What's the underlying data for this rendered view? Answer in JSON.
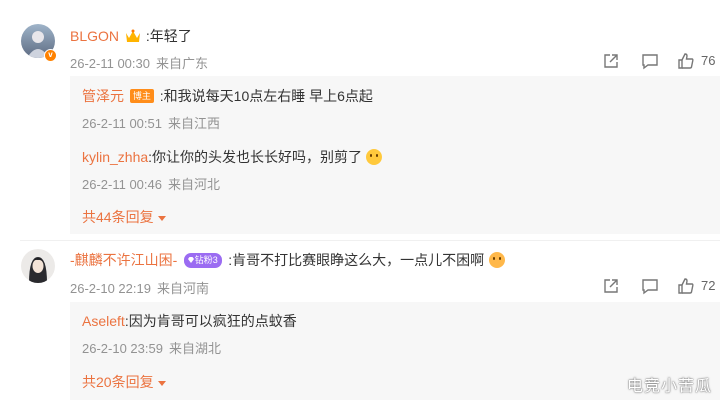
{
  "comments": [
    {
      "user": "BLGON",
      "text": ":年轻了",
      "date": "26-2-11 00:30",
      "location": "来自广东",
      "like_count": "76",
      "replies": [
        {
          "user": "管泽元",
          "tag": "博主",
          "text": ":和我说每天10点左右睡 早上6点起",
          "date": "26-2-11 00:51",
          "location": "来自江西"
        },
        {
          "user": "kylin_zhha",
          "text": ":你让你的头发也长长好吗，别剪了",
          "date": "26-2-11 00:46",
          "location": "来自河北"
        }
      ],
      "more_replies": "共44条回复"
    },
    {
      "user": "-麒麟不许江山困-",
      "fan_tag": "钻粉3",
      "text": ":肯哥不打比赛眼睁这么大，一点儿不困啊",
      "date": "26-2-10 22:19",
      "location": "来自河南",
      "like_count": "72",
      "replies": [
        {
          "user": "Aseleft",
          "text": ":因为肯哥可以疯狂的点蚊香",
          "date": "26-2-10 23:59",
          "location": "来自湖北"
        }
      ],
      "more_replies": "共20条回复"
    }
  ],
  "watermark": "电竞小苦瓜",
  "colors": {
    "username": "#eb7340",
    "meta": "#939393",
    "reply_bg": "#f7f7f7"
  }
}
